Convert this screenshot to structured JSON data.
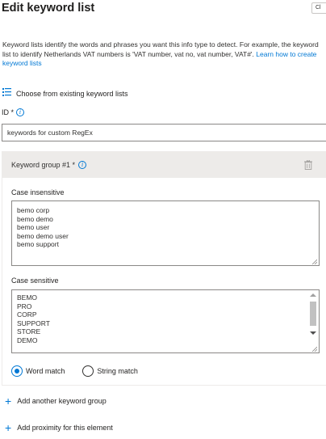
{
  "panel": {
    "title": "Edit keyword list",
    "close_chip": "Cl"
  },
  "description": {
    "text": "Keyword lists identify the words and phrases you want this info type to detect. For example, the keyword list to identify Netherlands VAT numbers is 'VAT number, vat no, vat number, VAT#'.",
    "link": "Learn how to create keyword lists"
  },
  "choose_existing": {
    "label": "Choose from existing keyword lists",
    "icon": "list-icon"
  },
  "id_field": {
    "label": "ID *",
    "value": "keywords for custom RegEx"
  },
  "keyword_group": {
    "title": "Keyword group #1 *",
    "case_insensitive": {
      "label": "Case insensitive",
      "items": [
        "bemo corp",
        "bemo demo",
        "bemo user",
        "bemo demo user",
        "bemo support"
      ]
    },
    "case_sensitive": {
      "label": "Case sensitive",
      "items": [
        "BEMO",
        "PRO",
        "CORP",
        "SUPPORT",
        "STORE",
        "DEMO"
      ]
    },
    "match_options": [
      {
        "label": "Word match",
        "selected": true
      },
      {
        "label": "String match",
        "selected": false
      }
    ]
  },
  "actions": {
    "add_group": "Add another keyword group",
    "add_proximity": "Add proximity for this element"
  },
  "colors": {
    "accent": "#0078d4",
    "header_bg": "#edebe9",
    "text": "#201f1e"
  }
}
